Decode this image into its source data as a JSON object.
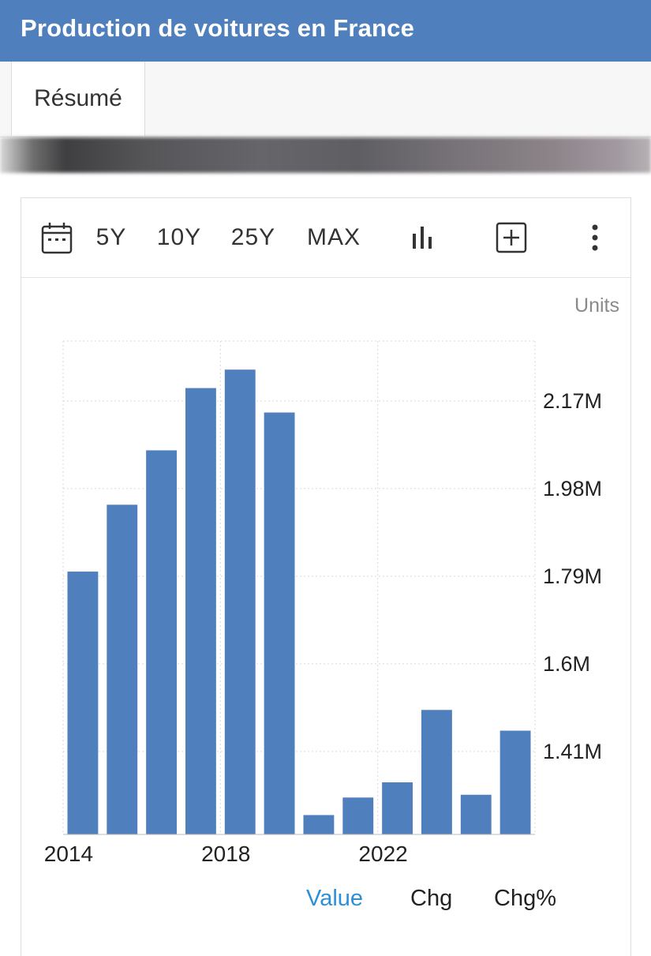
{
  "header": {
    "title": "Production de voitures en France"
  },
  "tabs": [
    {
      "label": "Résumé",
      "active": true
    }
  ],
  "toolbar": {
    "calendar_icon": "calendar-icon",
    "ranges": [
      "5Y",
      "10Y",
      "25Y",
      "MAX"
    ],
    "chart_type_icon": "bar-chart-icon",
    "add_icon": "plus-box-icon",
    "menu_icon": "vertical-dots-icon"
  },
  "units_label": "Units",
  "legend": {
    "items": [
      "Value",
      "Chg",
      "Chg%"
    ],
    "active": "Value",
    "active_color": "#2d8fd5",
    "inactive_color": "#222222"
  },
  "colors": {
    "header": "#4f80bd",
    "bar": "#4f80bd"
  },
  "chart_data": {
    "type": "bar",
    "categories": [
      "2014",
      "2015",
      "2016",
      "2017",
      "2018",
      "2019",
      "2020",
      "2021",
      "2022",
      "2023",
      "2024",
      "2025"
    ],
    "values": [
      1.8,
      1.945,
      2.063,
      2.198,
      2.238,
      2.145,
      1.272,
      1.31,
      1.343,
      1.5,
      1.316,
      1.455
    ],
    "ylim": [
      1.23,
      2.3
    ],
    "yticks": [
      1.41,
      1.6,
      1.79,
      1.98,
      2.17
    ],
    "ytick_labels": [
      "1.41M",
      "1.6M",
      "1.79M",
      "1.98M",
      "2.17M"
    ],
    "xtick_labels": [
      "2014",
      "2018",
      "2022"
    ],
    "y_axis_position": "right",
    "grid": true
  }
}
